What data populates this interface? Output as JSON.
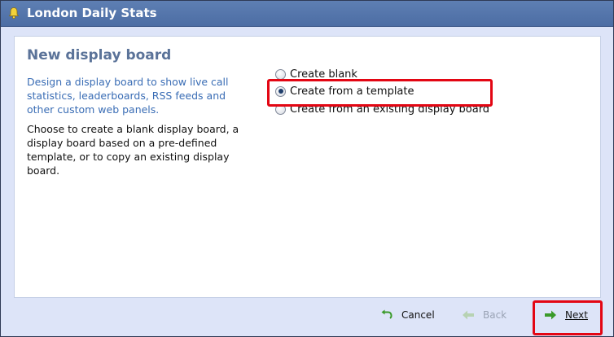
{
  "window": {
    "title": "London Daily Stats"
  },
  "content": {
    "heading": "New display board",
    "description": "Design a display board to show live call statistics, leaderboards, RSS feeds and other custom web panels.",
    "instructions": "Choose to create a blank display board, a display board based on a pre-defined template, or to copy an existing display board."
  },
  "options": [
    {
      "label": "Create blank",
      "selected": false
    },
    {
      "label": "Create from a template",
      "selected": true
    },
    {
      "label": "Create from an existing display board",
      "selected": false
    }
  ],
  "footer": {
    "cancel_label": "Cancel",
    "back_label": "Back",
    "next_label": "Next"
  },
  "colors": {
    "titlebar": "#4f70a8",
    "dialog_bg": "#dde4f8",
    "heading": "#5b7399",
    "description": "#3a6db5",
    "highlight": "#e30613",
    "next_arrow": "#3a9a2a"
  }
}
